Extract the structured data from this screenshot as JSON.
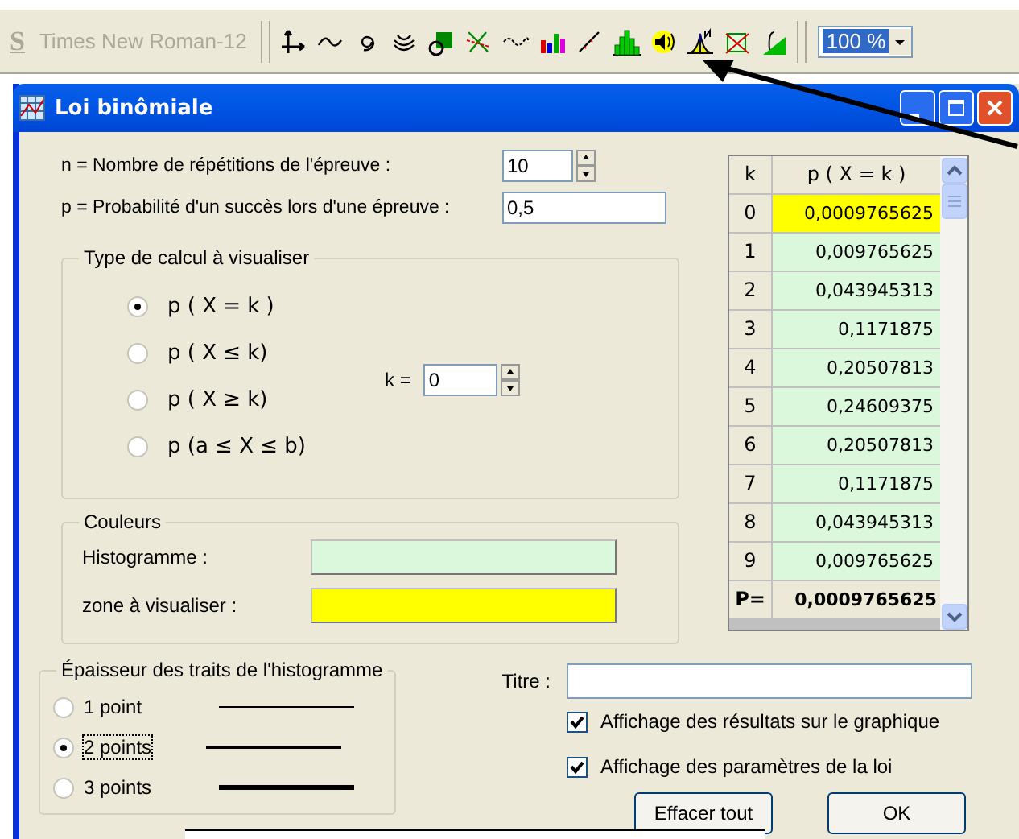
{
  "toolbar": {
    "style_button": "S",
    "font_box": "Times New Roman-12",
    "tools": [
      {
        "kind": "axes"
      },
      {
        "kind": "wave"
      },
      {
        "kind": "spiral"
      },
      {
        "kind": "arcs"
      },
      {
        "kind": "shapes"
      },
      {
        "kind": "cross"
      },
      {
        "kind": "dotwave"
      },
      {
        "kind": "bars"
      },
      {
        "kind": "line"
      },
      {
        "kind": "histogram"
      },
      {
        "kind": "speaker"
      },
      {
        "kind": "normal"
      },
      {
        "kind": "square"
      },
      {
        "kind": "integral"
      }
    ],
    "zoom": {
      "value": "100 %"
    }
  },
  "window": {
    "title": "Loi binômiale"
  },
  "params": [
    {
      "label": "n = Nombre de répétitions de l'épreuve :",
      "value": "10",
      "kind": "spin"
    },
    {
      "label": "p = Probabilité d'un succès lors d'une épreuve :",
      "value": "0,5",
      "kind": "text"
    }
  ],
  "calc_type": {
    "title": "Type de calcul à visualiser",
    "options": [
      {
        "label": "p ( X = k )",
        "selected": true
      },
      {
        "label": "p ( X ≤ k)",
        "selected": false
      },
      {
        "label": "p ( X ≥ k)",
        "selected": false
      },
      {
        "label": "p (a ≤ X ≤ b)",
        "selected": false
      }
    ],
    "k_label": "k =",
    "k_value": "0"
  },
  "colors": {
    "title": "Couleurs",
    "items": [
      {
        "label": "Histogramme :",
        "color": "#dcf8dc"
      },
      {
        "label": "zone à visualiser :",
        "color": "#ffff00"
      }
    ]
  },
  "thickness": {
    "title": "Épaisseur des traits de l'histogramme",
    "options": [
      {
        "label": "1 point",
        "selected": false,
        "kind": "thin"
      },
      {
        "label": "2 points",
        "selected": true,
        "kind": "medium"
      },
      {
        "label": "3 points",
        "selected": false,
        "kind": "thick"
      }
    ]
  },
  "table": {
    "columns": [
      "k",
      "p ( X = k )"
    ],
    "rows": [
      {
        "k": "0",
        "p": "0,0009765625",
        "selected": true
      },
      {
        "k": "1",
        "p": "0,009765625",
        "selected": false
      },
      {
        "k": "2",
        "p": "0,043945313",
        "selected": false
      },
      {
        "k": "3",
        "p": "0,1171875",
        "selected": false
      },
      {
        "k": "4",
        "p": "0,20507813",
        "selected": false
      },
      {
        "k": "5",
        "p": "0,24609375",
        "selected": false
      },
      {
        "k": "6",
        "p": "0,20507813",
        "selected": false
      },
      {
        "k": "7",
        "p": "0,1171875",
        "selected": false
      },
      {
        "k": "8",
        "p": "0,043945313",
        "selected": false
      },
      {
        "k": "9",
        "p": "0,009765625",
        "selected": false
      }
    ],
    "footer": {
      "label": "P=",
      "value": "0,0009765625"
    }
  },
  "title_field": {
    "label": "Titre :"
  },
  "checkboxes": [
    {
      "label": "Affichage des résultats sur le graphique",
      "checked": true
    },
    {
      "label": "Affichage des paramètres de la loi",
      "checked": true
    }
  ],
  "buttons": [
    "Effacer tout",
    "OK"
  ]
}
